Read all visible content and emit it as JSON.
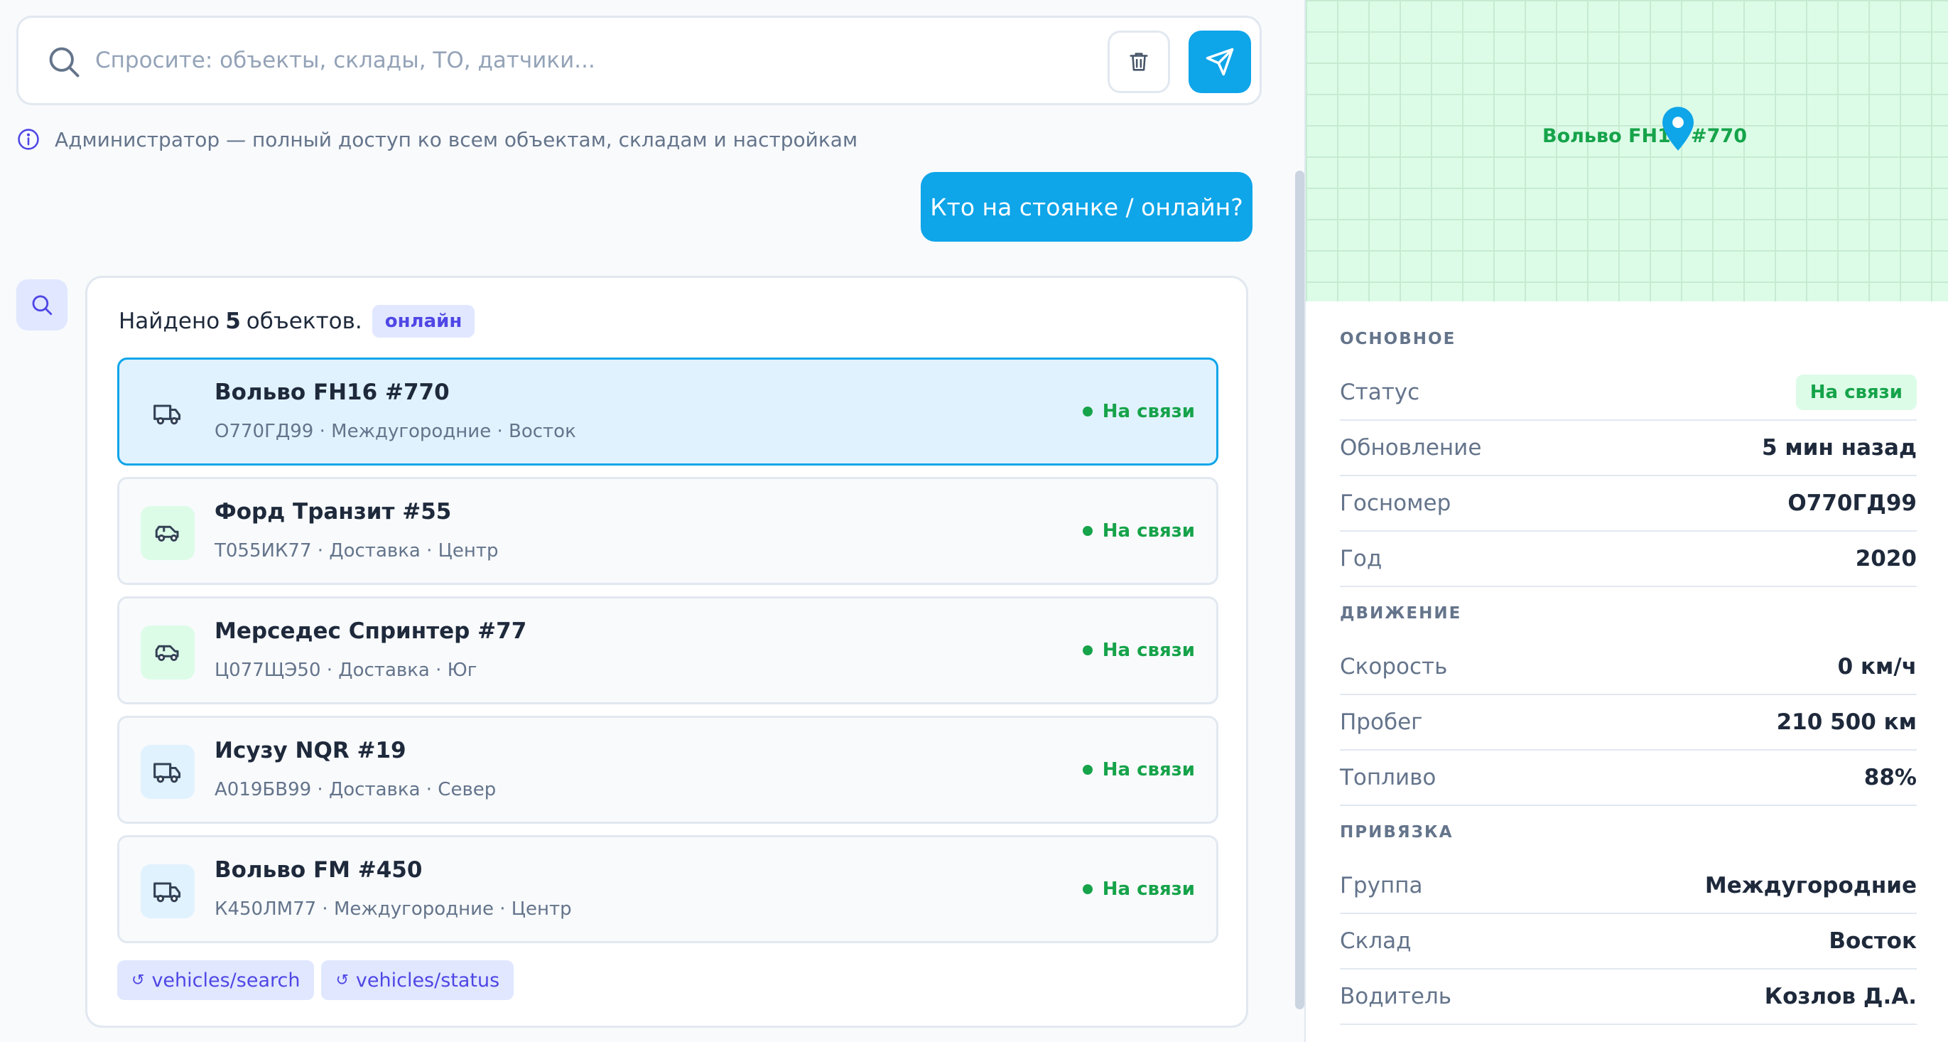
{
  "search": {
    "placeholder": "Спросите: объекты, склады, ТО, датчики..."
  },
  "icons": {
    "search": "search-icon",
    "trash": "trash-icon",
    "send": "send-icon",
    "info": "info-icon",
    "truck": "truck-icon",
    "van": "van-icon",
    "pin": "map-pin-icon"
  },
  "colors": {
    "accent": "#0ea5e9",
    "online": "#16a34a",
    "badge": "#4f46e5"
  },
  "role_info": "Администратор — полный доступ ко всем объектам, складам и настройкам",
  "user_message": "Кто на стоянке / онлайн?",
  "answer": {
    "found_prefix": "Найдено",
    "found_count": "5",
    "found_suffix": "объектов.",
    "filter_badge": "онлайн",
    "vehicles": [
      {
        "name": "Вольво FH16 #770",
        "sub": "О770ГД99 · Междугородние · Восток",
        "status": "На связи",
        "icon": "truck-icon",
        "selected": true
      },
      {
        "name": "Форд Транзит #55",
        "sub": "Т055ИК77 · Доставка · Центр",
        "status": "На связи",
        "icon": "van-icon"
      },
      {
        "name": "Мерседес Спринтер #77",
        "sub": "Ц077ЩЭ50 · Доставка · Юг",
        "status": "На связи",
        "icon": "van-icon"
      },
      {
        "name": "Исузу NQR #19",
        "sub": "А019БВ99 · Доставка · Север",
        "status": "На связи",
        "icon": "truck-icon"
      },
      {
        "name": "Вольво FM #450",
        "sub": "К450ЛМ77 · Междугородние · Центр",
        "status": "На связи",
        "icon": "truck-icon"
      }
    ],
    "tools": [
      {
        "arc": "↺",
        "label": "vehicles/search"
      },
      {
        "arc": "↺",
        "label": "vehicles/status"
      }
    ]
  },
  "map": {
    "label": "Вольво FH16 #770"
  },
  "details": {
    "sections": [
      {
        "title": "ОСНОВНОЕ",
        "rows": [
          {
            "key": "Статус",
            "value": "На связи",
            "pill": true
          },
          {
            "key": "Обновление",
            "value": "5 мин назад"
          },
          {
            "key": "Госномер",
            "value": "О770ГД99"
          },
          {
            "key": "Год",
            "value": "2020"
          }
        ]
      },
      {
        "title": "ДВИЖЕНИЕ",
        "rows": [
          {
            "key": "Скорость",
            "value": "0 км/ч"
          },
          {
            "key": "Пробег",
            "value": "210 500 км"
          },
          {
            "key": "Топливо",
            "value": "88%"
          }
        ]
      },
      {
        "title": "ПРИВЯЗКА",
        "rows": [
          {
            "key": "Группа",
            "value": "Междугородние"
          },
          {
            "key": "Склад",
            "value": "Восток"
          },
          {
            "key": "Водитель",
            "value": "Козлов Д.А."
          }
        ]
      }
    ]
  }
}
